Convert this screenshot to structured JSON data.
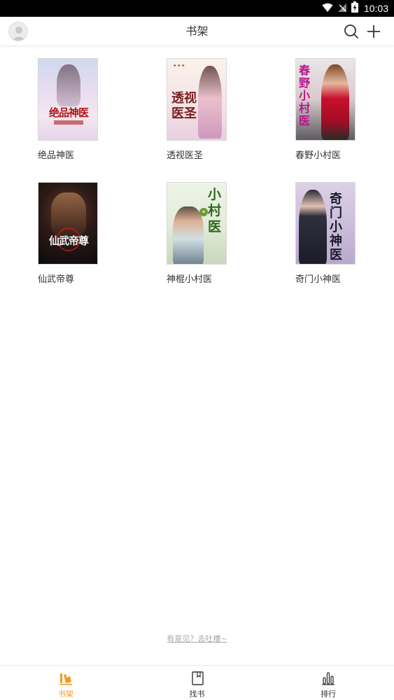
{
  "status_bar": {
    "time": "10:03"
  },
  "header": {
    "title": "书架"
  },
  "books": [
    {
      "title": "绝品神医",
      "cover_text": "绝品神医"
    },
    {
      "title": "透视医圣",
      "cover_text": "透视医圣"
    },
    {
      "title": "春野小村医",
      "cover_text": "春野小村医"
    },
    {
      "title": "仙武帝尊",
      "cover_text": "仙武帝尊"
    },
    {
      "title": "神棍小村医",
      "cover_text": "小村医"
    },
    {
      "title": "奇门小神医",
      "cover_text": "奇门小神医"
    }
  ],
  "feedback": {
    "label": "有意见？去吐槽~"
  },
  "nav": {
    "items": [
      {
        "label": "书架",
        "icon": "bookshelf-icon",
        "active": true
      },
      {
        "label": "找书",
        "icon": "book-icon",
        "active": false
      },
      {
        "label": "排行",
        "icon": "ranking-icon",
        "active": false
      }
    ]
  },
  "colors": {
    "accent": "#f39a1f",
    "text": "#333333",
    "muted": "#aaaaaa"
  }
}
